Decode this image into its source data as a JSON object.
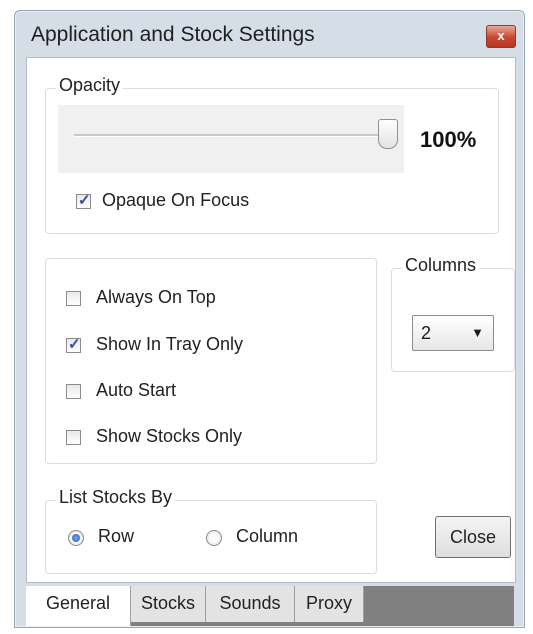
{
  "window": {
    "title": "Application and Stock Settings",
    "close_glyph": "x"
  },
  "opacity": {
    "legend": "Opacity",
    "value": 100,
    "value_label": "100%",
    "opaque_on_focus": {
      "label": "Opaque On Focus",
      "checked": true
    }
  },
  "options": [
    {
      "label": "Always On Top",
      "checked": false
    },
    {
      "label": "Show In Tray Only",
      "checked": true
    },
    {
      "label": "Auto Start",
      "checked": false
    },
    {
      "label": "Show Stocks Only",
      "checked": false
    }
  ],
  "columns": {
    "legend": "Columns",
    "selected": "2"
  },
  "list_stocks_by": {
    "legend": "List Stocks By",
    "options": [
      {
        "label": "Row",
        "selected": true
      },
      {
        "label": "Column",
        "selected": false
      }
    ]
  },
  "close_button": {
    "label": "Close"
  },
  "tabs": [
    {
      "label": "General",
      "active": true
    },
    {
      "label": "Stocks",
      "active": false
    },
    {
      "label": "Sounds",
      "active": false
    },
    {
      "label": "Proxy",
      "active": false
    }
  ],
  "colors": {
    "accent": "#1f58b8",
    "title_bar": "#d5dde7",
    "close_red": "#c9472f"
  }
}
